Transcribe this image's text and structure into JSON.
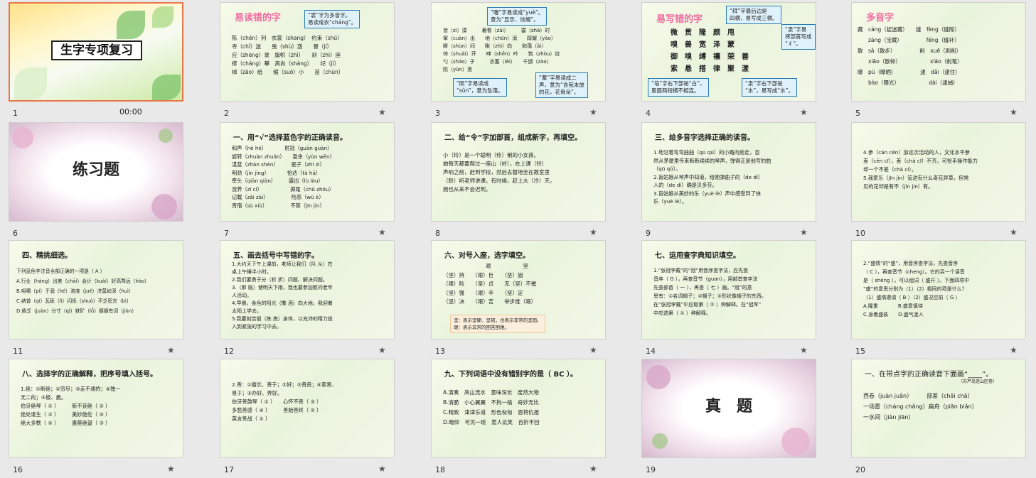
{
  "app": {
    "time_display": "00:00"
  },
  "slides": [
    {
      "n": "1",
      "title": "生字专项复习"
    },
    {
      "n": "2",
      "heading": "易读错的字",
      "callout1": "“裳”字为多音字。\n易读成衣“cháng”。",
      "body": "陈（chén）列　衣裳（shang）　约束（shù）\n寺（chǐ）迷　　曳（shù）惑　　督（jí）\n应（zhèng）录　旗帜（zhì）　　刹（zhì）座\n撑（cháng）攀　高尚（shàng）　　纪（jì）\n棹（zāo）纸　　缩（suō）小　　苗（chún）"
    },
    {
      "n": "3",
      "callout1": "“喔”字易读成“yuè”。\n意为“显示、炫耀”。",
      "body": "皆（zì）漠　　　暑看（zāi）　　　霎（shà）时\n窜（cuàn）出　　地（chūn）消　　踩耀（yào）\n瞬（shùn）间　　瞅（zhì）向　　和蔼（ǎi）\n帅（shuài）开　　呻（shēn）吟　　筑（zhòu）纹\n勺（sháo）子　　　衣蓄（lěi）　　千颁（zào）\n陨（yǔn）落",
      "callout2": "“陨”字易读成\n“sǔn”，意为坠落。",
      "callout3": "“蓄”字易读成二\n声，意为“含苞未放\n的花，花骨朵”。"
    },
    {
      "n": "4",
      "heading": "易写错的字",
      "callout1": "“拜”字最后边是\n四横，易写成三横。",
      "callout2": "“泉”字易\n将部首写成\n“彳”。",
      "body": "微　贯　隆　颇　甩\n嗅　兽　宽　泽　蒙\n御　嗅　缚　禳　荣　善\n索　悬　搭　律　聚　漾",
      "callout3": "“培”字右下部是“白”，\n里面两短横不相连。",
      "callout4": "“泉”字右下部是\n“水”，易写成“水”。"
    },
    {
      "n": "5",
      "heading": "多音字",
      "body": "藏　cáng（捉迷藏）　　缝　fèng（缝隙）\n　　zàng（宝藏）　　　　　féng（缝补）\n散　sǎ（散步）　　　　　削　xuē（剥削）\n　　xiāo（散钟）　　　　　　xiāo（削笔）\n曝　pù（曝晒）　　　　　逮　dǎi（逮住）\n　　bào（曝光）　　　　　　dài（逮捕）"
    },
    {
      "n": "6",
      "title": "练习题"
    },
    {
      "n": "7",
      "heading": "一、用“√”选择蓝色字的正确读音。",
      "body": "和声（hè hé）　　　　射冠（guān guàn）\n旋转（zhuàn zhuǎn）　　盈余（yùn wēn）\n湛蓝（zhàn shèn）　　　抿子（zhī zi）\n明劲（jìn jìng）　　　　恰达（tà hā）\n牵头（qiān qiàn）　　　露出（lù lòu）\n涨养（zī cǐ）　　　　　　掷尾（chǔ zhōu）\n记载（zǎi zài）　　　　　险恶（wù è）\n宵宿（sù xiù）　　　　　不禁（jīn jìn）"
    },
    {
      "n": "8",
      "heading": "二、给“令”字加部首，组成新字，再填空。",
      "body": "小（玲）是一个聪明（伶）俐的小女孩。\n她每天都要爬过一座山（岭），在上课（铃）\n声响之前，赶到学校，然后去替地坐在教室里\n（聆）听老师讲课。有时候，赶上大（冷）天，\n她也从来不会迟到。"
    },
    {
      "n": "9",
      "heading": "三、给多音字选择正确的读音。",
      "body": "1.地沿着弯弯曲曲（qū qǔ）的小路向前走，忽\n然从茅屋里传来断断续续的琴声，弹得正是他写的曲\n（qū qǔ）。\n2.盲姑娘从琴声中知道，给她弹曲子的（de dí）\n人的（de dí）确是贝多芬。\n3.盲姑娘从美妙的乐（yuè lè）声中感受到了快\n乐（yuè lè）。"
    },
    {
      "n": "10",
      "body": "4.参（cān cēn）加这次活动的人，文化水平参\n差（cēn cī），差（chà cī）不齐。可恰手操作能力\n却一个不差（chà cī）。\n5.我家乐（jīn jìn）管这有什么奇花异草，但常\n见的花却是有不（jǐn jìn）有。"
    },
    {
      "n": "11",
      "heading": "四、精挑细选。",
      "body": "下列蓝色字注音全部正确的一项是（ A ）\nA.行业（háng）出差（chāi）会计（kuài）好高骛远（hào）\nB.咀嚼（pí）于涸（hé）溶液（jué）济莫如深（huì）\nC.纳曾（qí）瓦砾（lì）闪烁（shuò）不乏狂言（bì）\nD.倦乏（juàn）分寸（qì）铁矿（lǚ）振振有词（jiàn）"
    },
    {
      "n": "12",
      "heading": "五、画去括号中写错的字。",
      "body": "1.大约天下午上课前，老师让我们（队 从）在\n桌上午睡半小时。\n2.我们要勇于分（析 折）问题、解决问题。\n3.（即 既）使明天下雨，我也要参加慰问老年\n人活动。\n4.早晨，金色的阳光（撒 洒）向大地，我迎着\n太阳上学去。\n5.我要刻苦锻（练 炼）身体，以充沛的精力投\n入到紧张的学习中去。"
    },
    {
      "n": "13",
      "heading": "六、对号入座，选字填空。",
      "body": "　　　　　　　　艰　　　　　　坚\n（坚）持　　（艰）巨　　（坚）固\n（艰）险　　（坚）贞　　无（坚）不摧\n（坚）强　　（艰）辛　　（坚）定\n（坚）决　　（艰）苦　　举步维（艰）",
      "note": "坚：表示坚硬、坚韧，也表示非常的坚固。\n艰：表示非常的困苦困难。"
    },
    {
      "n": "14",
      "heading": "七、运用查字典知识填空。",
      "body": "1.“张冠李戴”的“冠”用音序查字法，应先查\n音序（ G ），再查音节（guan），用部首查字法\n先查部首（ 一 ），再查（ 七 ）画。“冠”的意\n思有：①名词帽子；②帽子；③形状像帽子的东西。\n在“张冠李戴”中应取第（ ② ）种解释。在“冠军”\n中应选第（ ① ）种解释。"
    },
    {
      "n": "15",
      "body": "2.“盛情”的“盛”，用音序查字法，先查音序\n（ C ），再查音节（cheng）。它的另一个读音\n是（ shèng ），可以组词（ 盛开 ）。下面四项中\n“盛”的意思分别为（1）（2）相同的项是什么？\n（1）盛情邀请（ B ）（2）盛况空前（ G ）\nA.隆重　　　　B.盛意慎待\nC.身着盛装　　D.盛气凌人"
    },
    {
      "n": "16",
      "heading": "八、选择字的正确解释，把序号填入括号。",
      "body": "1.绝：①断绝；②穷尽；③走不通的；④独一\n无二的；⑤极、最。\n伯牙绝琴（ ① ）　　　新不丧绝（ ② ）\n绝处逢生（ ③ ）　　　美妙绝伦（ ⑤ ）\n绝大多数（ ⑤ ）　　　惠莫绝望（ ③ ）"
    },
    {
      "n": "17",
      "body": "2.善：①擅长、善于；②好；③善良；④家易、\n易于；⑤办好、弄好。\n伯牙善鼓琴（ ① ）　　心怀不善（ ③ ）\n多愁善感（ ④ ）　　　善始善终（ ② ）\n英言善战（ ① ）"
    },
    {
      "n": "18",
      "heading": "九、下列词语中没有错别字的是（ BC ）。",
      "body": "A.演奏　高山流水　意味深长　废然大物\nB.清脆　小心翼翼　不拘一格　奇妙无比\nC.精致　津津乐道　形色匆匆　恩将仇报\nD.暗仰　可见一斑　惹人讥笑　百折不回"
    },
    {
      "n": "19",
      "title": "真　题"
    },
    {
      "n": "20",
      "heading": "一、在带点字的正确读音下面画“____”。",
      "sub": "（苏芦岛连山区卷）",
      "body": "西卷（juàn juǎn）　　　部差（chāi chā）\n一场雷（cháng chǎng）扁舟（piān biǎn）\n一水间（jiàn jiān）"
    }
  ]
}
